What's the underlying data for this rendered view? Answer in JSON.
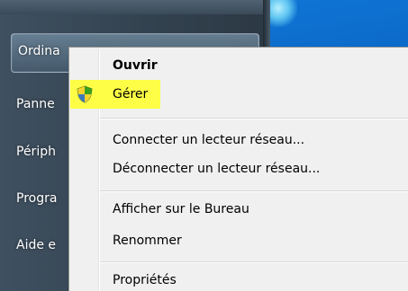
{
  "start_menu": {
    "items": [
      {
        "label": "Ordina"
      },
      {
        "label": "Panne"
      },
      {
        "label": "Périph"
      },
      {
        "label": "Progra"
      },
      {
        "label": "Aide e"
      }
    ]
  },
  "context_menu": {
    "items": [
      {
        "label": "Ouvrir",
        "default": true
      },
      {
        "label": "Gérer",
        "icon": "uac-shield-icon",
        "highlighted": true
      },
      {
        "label": "Connecter un lecteur réseau..."
      },
      {
        "label": "Déconnecter un lecteur réseau..."
      },
      {
        "label": "Afficher sur le Bureau"
      },
      {
        "label": "Renommer"
      },
      {
        "label": "Propriétés"
      }
    ]
  },
  "colors": {
    "highlight": "#ffff33",
    "menu_bg": "#f0f0f0",
    "desktop": "#0a63c1"
  }
}
